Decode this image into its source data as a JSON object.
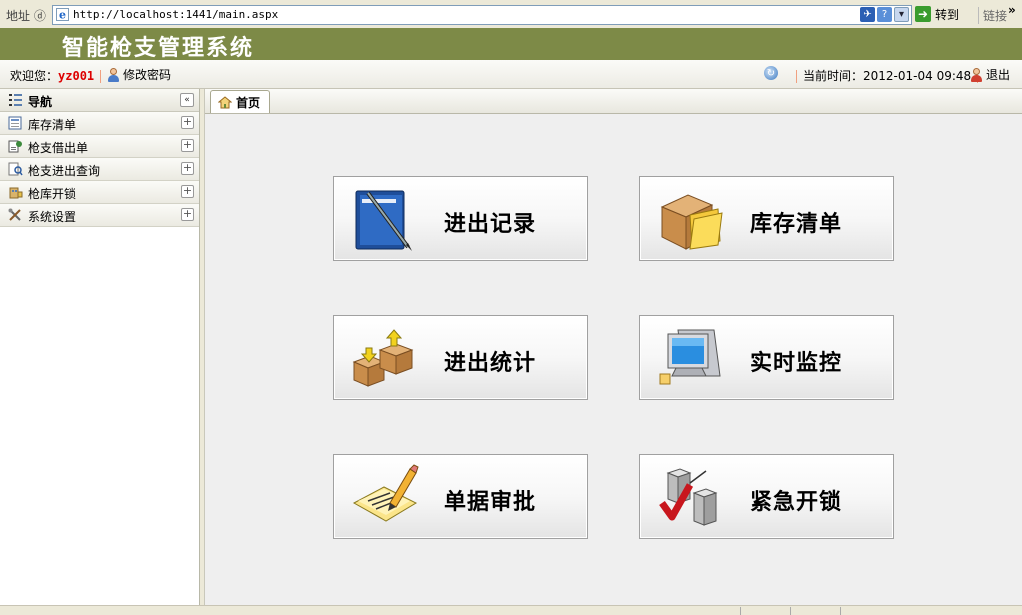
{
  "browser": {
    "address_label": "地址 ⓓ",
    "url": "http://localhost:1441/main.aspx",
    "go_label": "转到",
    "links_label": "链接",
    "more_label": "»"
  },
  "app": {
    "title": "智能枪支管理系统",
    "accent_color": "#7d8a47"
  },
  "userbar": {
    "welcome_label": "欢迎您：",
    "username": "yz001",
    "change_password": "修改密码",
    "time_label": "当前时间：",
    "time_value": "2012-01-04 09:48",
    "logout": "退出"
  },
  "sidebar": {
    "header": "导航",
    "items": [
      {
        "label": "库存清单",
        "icon": "inventory-list-icon"
      },
      {
        "label": "枪支借出单",
        "icon": "loan-form-icon"
      },
      {
        "label": "枪支进出查询",
        "icon": "search-records-icon"
      },
      {
        "label": "枪库开锁",
        "icon": "building-lock-icon"
      },
      {
        "label": "系统设置",
        "icon": "tools-icon"
      }
    ]
  },
  "tabs": [
    {
      "label": "首页",
      "icon": "home-icon",
      "active": true
    }
  ],
  "tiles": [
    {
      "label": "进出记录",
      "icon": "notebook-pen-icon"
    },
    {
      "label": "库存清单",
      "icon": "box-folder-icon"
    },
    {
      "label": "进出统计",
      "icon": "boxes-arrows-icon"
    },
    {
      "label": "实时监控",
      "icon": "computer-monitor-icon"
    },
    {
      "label": "单据审批",
      "icon": "document-pencil-icon"
    },
    {
      "label": "紧急开锁",
      "icon": "servers-checkmark-icon"
    }
  ]
}
